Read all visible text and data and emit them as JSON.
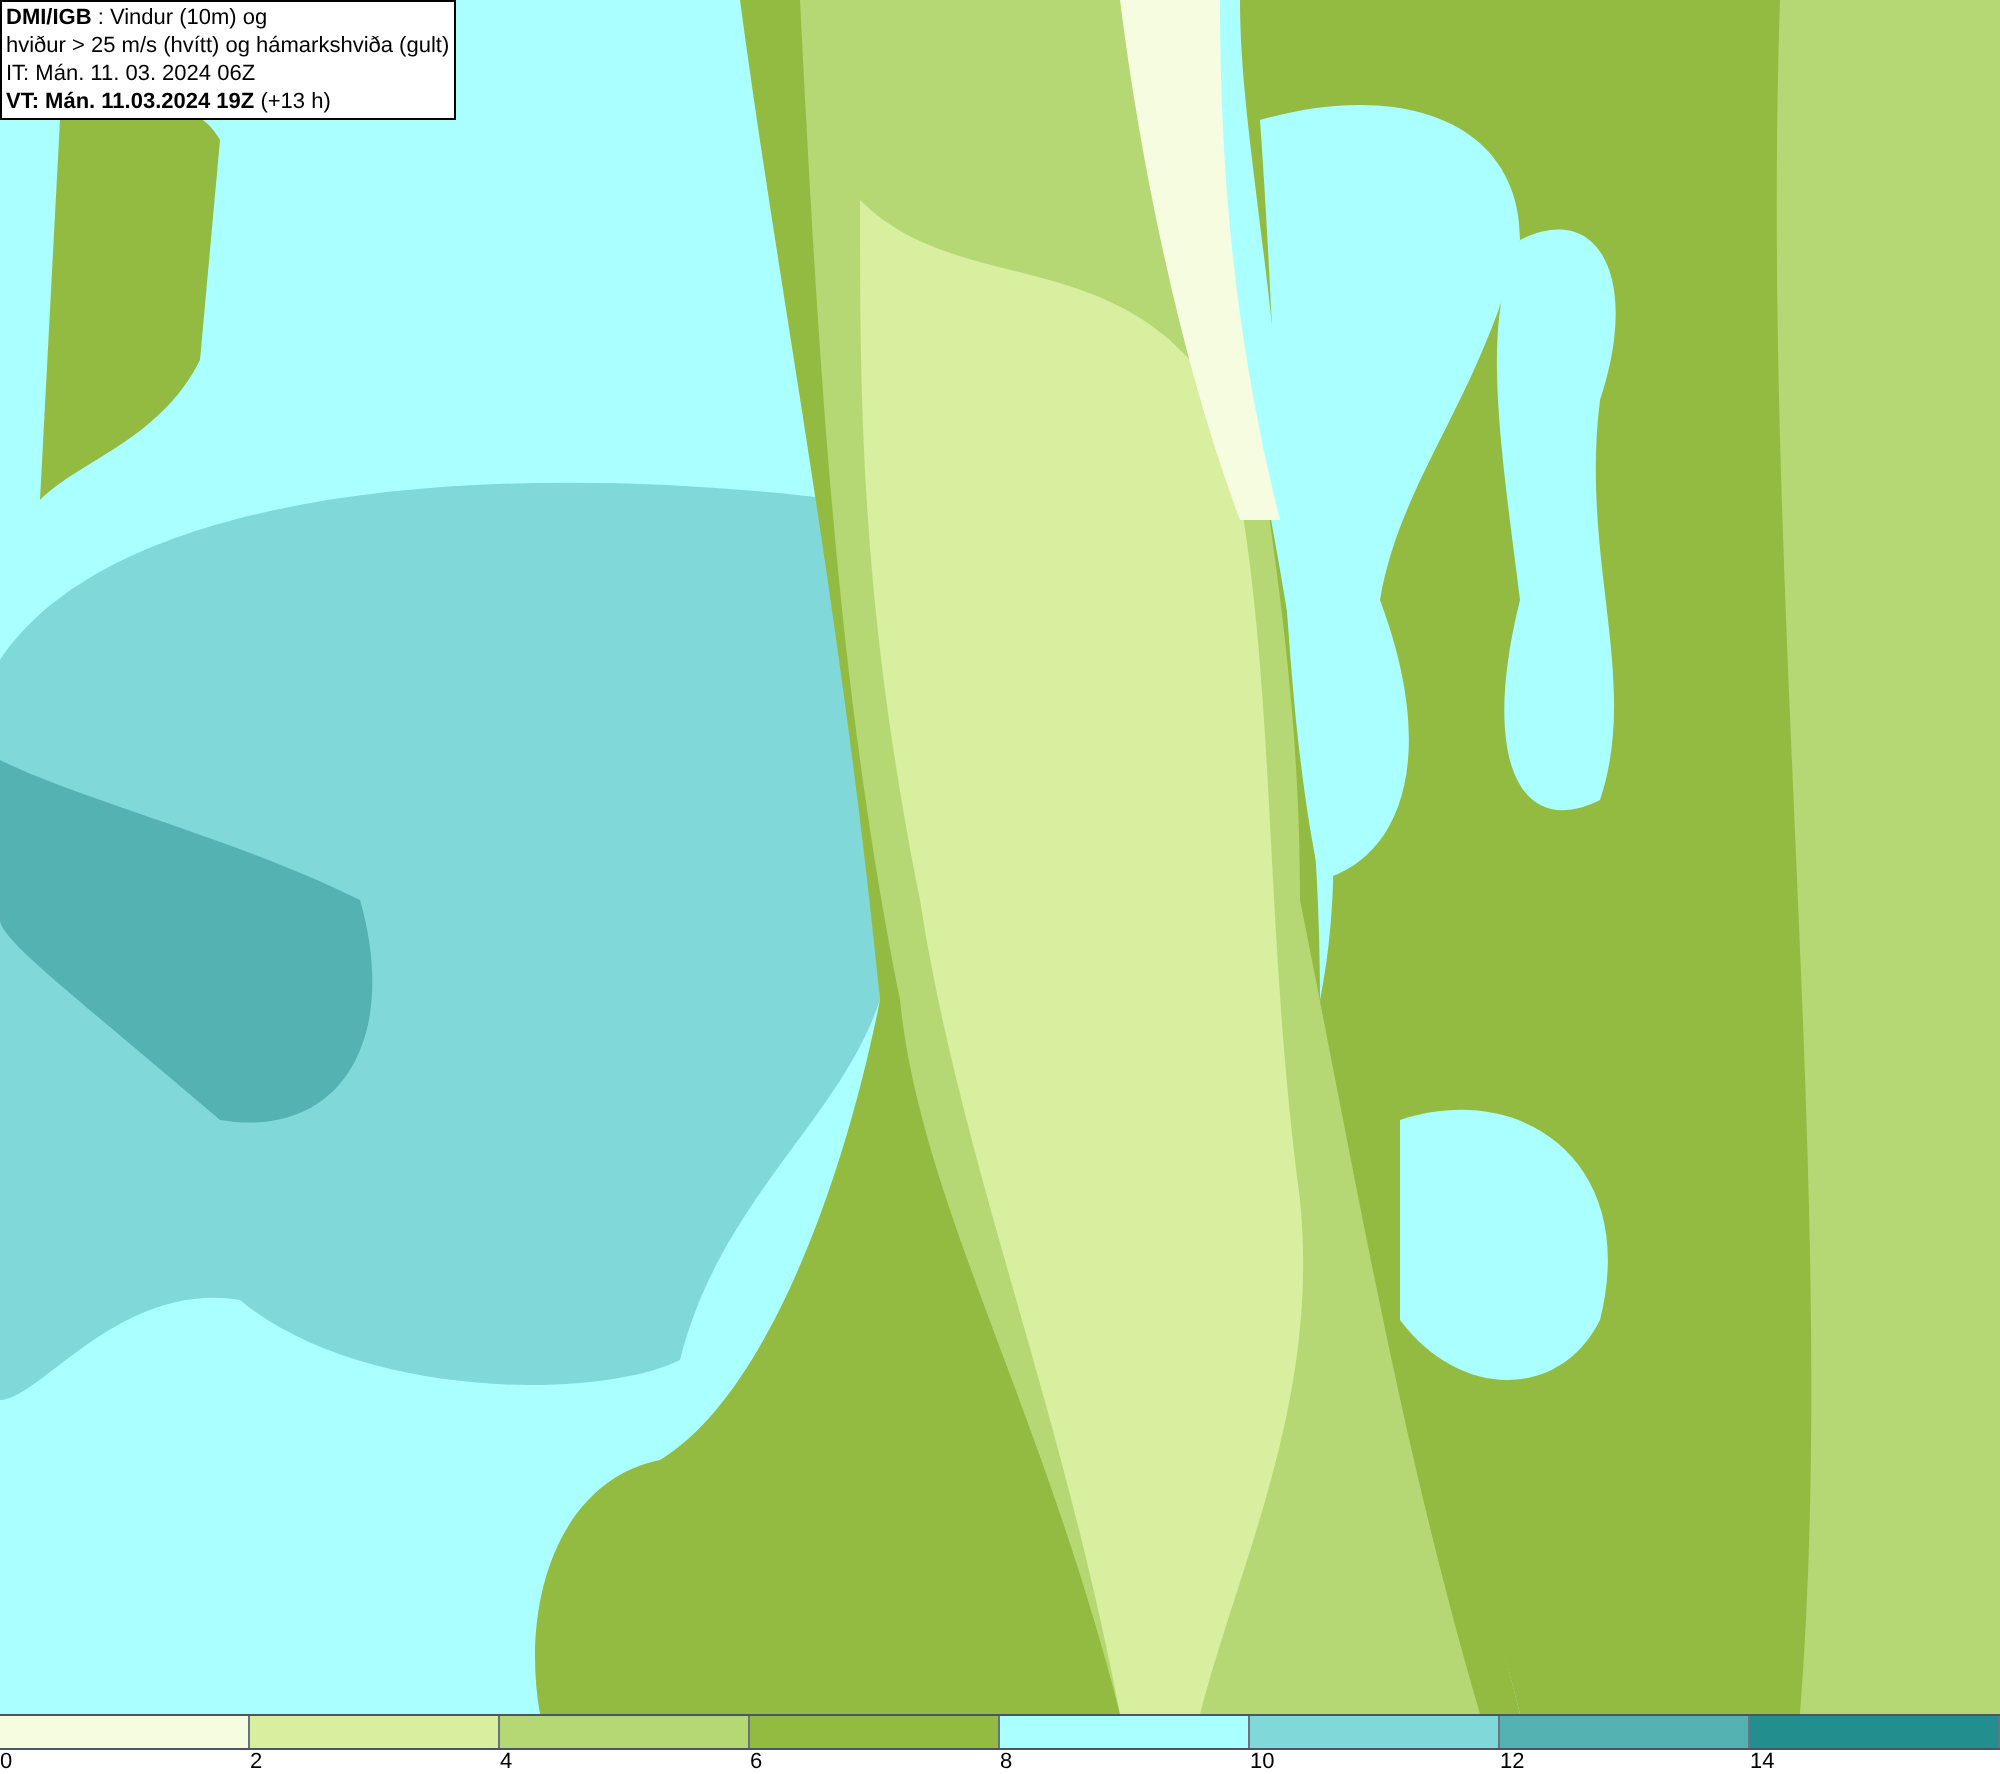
{
  "info_box": {
    "lines": [
      "**DMI/IGB** : Vindur (10m) og",
      "hviður > 25 m/s (hvítt) og hámarkshviða (gult)",
      "IT: Mán. 11. 03. 2024 06Z",
      "**VT: Mán. 11.03.2024 19Z** (+13 h)"
    ]
  },
  "legend": [
    {
      "label": "0",
      "color": "#f5fce0"
    },
    {
      "label": "2",
      "color": "#d8ef9f"
    },
    {
      "label": "4",
      "color": "#b6d874"
    },
    {
      "label": "6",
      "color": "#93bb42"
    },
    {
      "label": "8",
      "color": "#aaffff"
    },
    {
      "label": "10",
      "color": "#80d8d8"
    },
    {
      "label": "12",
      "color": "#55b2b2"
    },
    {
      "label": "14",
      "color": "#238e8e"
    }
  ]
}
